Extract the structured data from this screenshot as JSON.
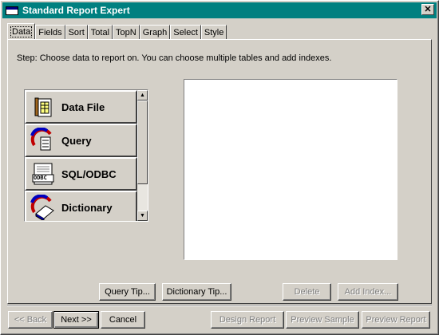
{
  "window": {
    "title": "Standard Report Expert",
    "close": "✕"
  },
  "tabs": [
    {
      "label": "Data",
      "active": true
    },
    {
      "label": "Fields"
    },
    {
      "label": "Sort"
    },
    {
      "label": "Total"
    },
    {
      "label": "TopN"
    },
    {
      "label": "Graph"
    },
    {
      "label": "Select"
    },
    {
      "label": "Style"
    }
  ],
  "step_text": "Step: Choose data to report on. You can choose multiple tables and add indexes.",
  "sources": [
    {
      "label": "Data File",
      "icon": "data-file-icon"
    },
    {
      "label": "Query",
      "icon": "query-icon"
    },
    {
      "label": "SQL/ODBC",
      "icon": "sql-odbc-icon",
      "icon_text": "ODBC"
    },
    {
      "label": "Dictionary",
      "icon": "dictionary-icon"
    }
  ],
  "panel_buttons": {
    "query_tip": "Query Tip...",
    "dictionary_tip": "Dictionary Tip...",
    "delete": "Delete",
    "add_index": "Add Index..."
  },
  "footer_buttons": {
    "back": "<< Back",
    "next": "Next >>",
    "cancel": "Cancel",
    "design_report": "Design Report",
    "preview_sample": "Preview Sample",
    "preview_report": "Preview Report"
  },
  "colors": {
    "titlebar": "#008080",
    "face": "#d4d0c8",
    "disabled_text": "#808080"
  }
}
